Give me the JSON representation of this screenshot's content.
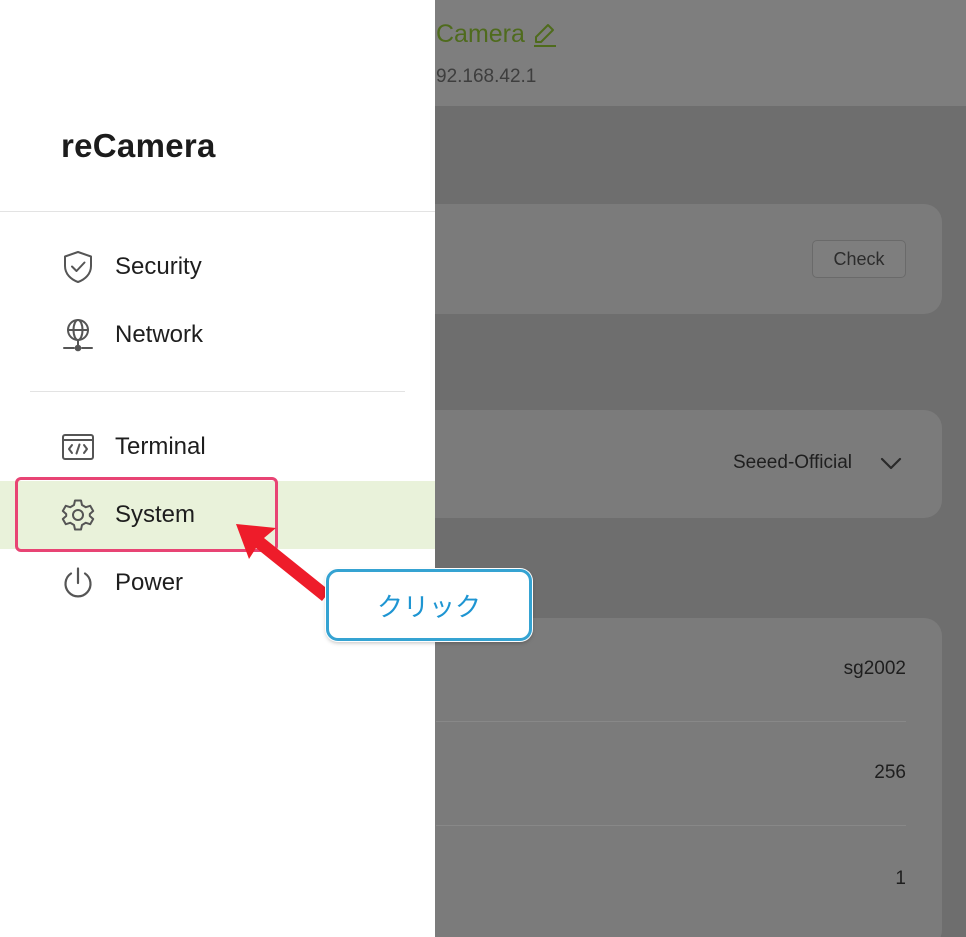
{
  "header": {
    "device_name": "Camera",
    "device_ip": "92.168.42.1"
  },
  "update_card": {
    "check_label": "Check"
  },
  "channel_card": {
    "selected_channel": "Seeed-Official"
  },
  "info_card": {
    "rows": [
      {
        "value": "sg2002"
      },
      {
        "value": "256"
      },
      {
        "value": "1"
      }
    ]
  },
  "drawer": {
    "title": "reCamera",
    "items": [
      {
        "label": "Security",
        "icon": "shield-check-icon"
      },
      {
        "label": "Network",
        "icon": "network-globe-icon"
      },
      {
        "label": "Terminal",
        "icon": "terminal-icon"
      },
      {
        "label": "System",
        "icon": "gear-icon",
        "active": true
      },
      {
        "label": "Power",
        "icon": "power-icon"
      }
    ]
  },
  "annotation": {
    "callout_text": "クリック",
    "highlight_color": "#e84474",
    "arrow_color": "#ee1c2a",
    "callout_border_color": "#35a3d2"
  },
  "colors": {
    "accent_green": "#e9f2da",
    "device_name_color": "#4f6b1d"
  }
}
